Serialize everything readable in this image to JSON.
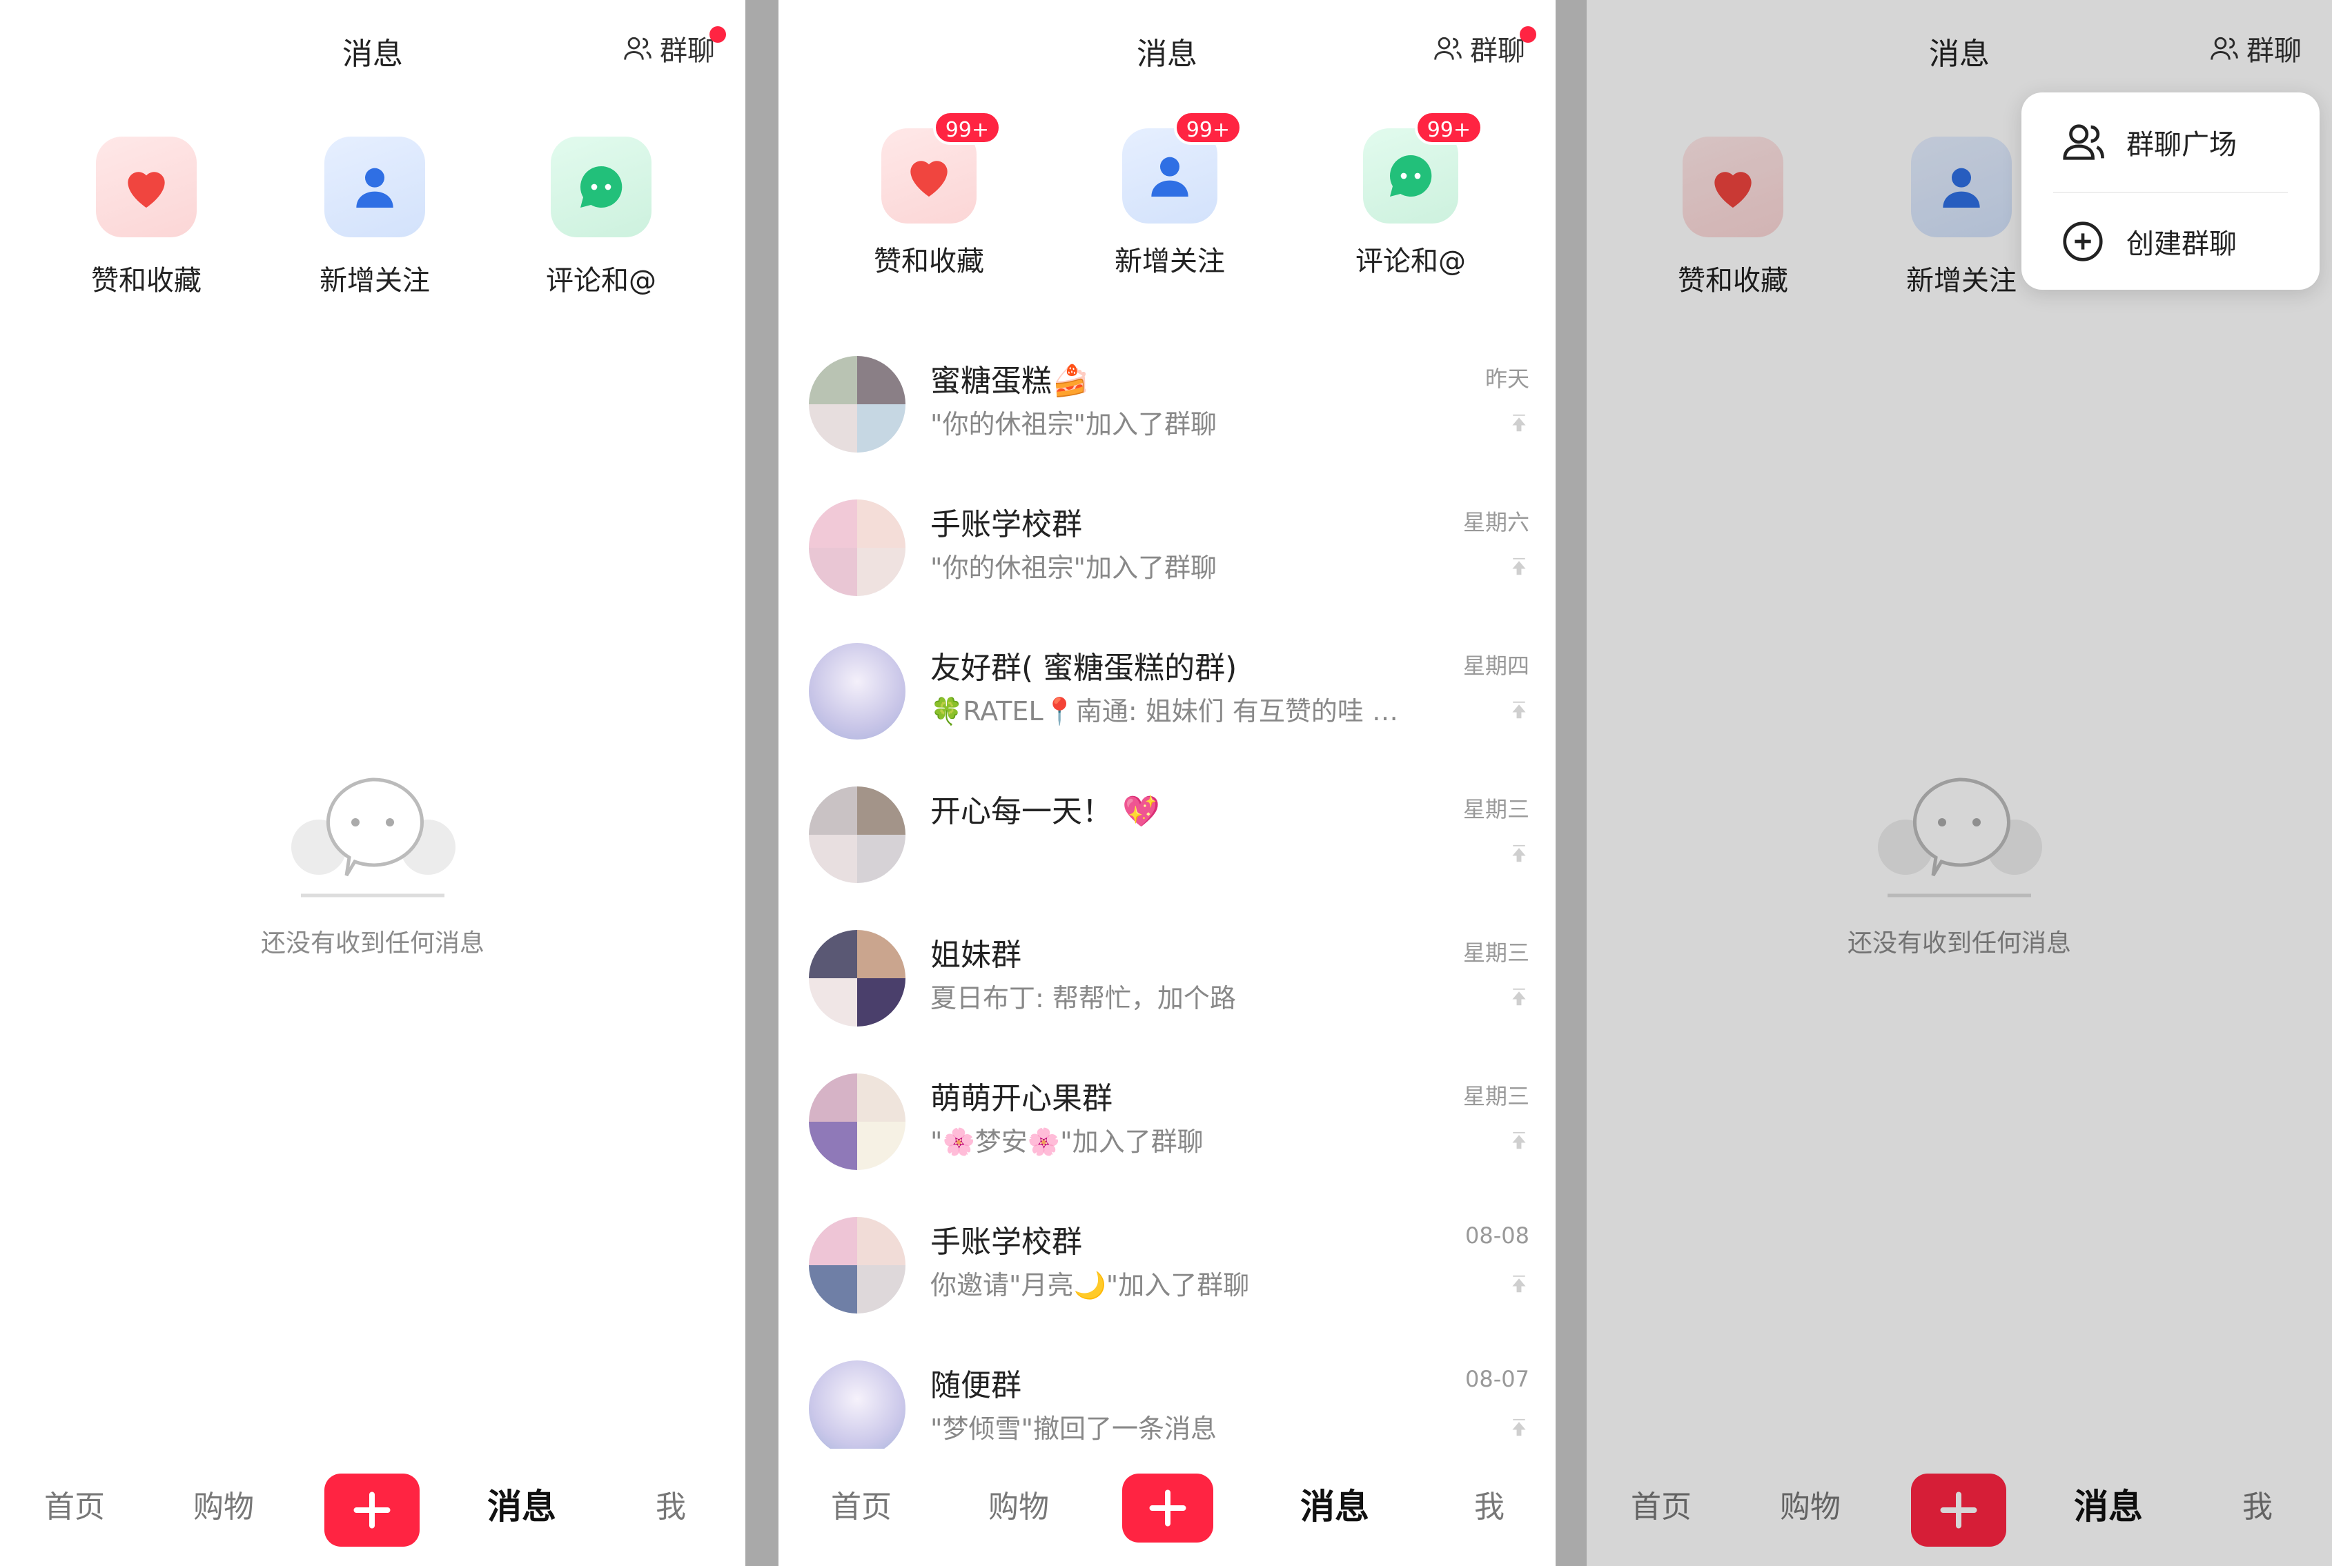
{
  "colors": {
    "brand_red": "#ff2442",
    "page_bg": "#ffffff",
    "gap_bg": "#a9a9a9"
  },
  "header": {
    "title": "消息",
    "group_chat_label": "群聊"
  },
  "entries": [
    {
      "label": "赞和收藏",
      "icon": "heart-icon"
    },
    {
      "label": "新增关注",
      "icon": "person-icon"
    },
    {
      "label": "评论和@",
      "icon": "chat-bubble-icon"
    }
  ],
  "entry_badge": "99+",
  "empty_state": {
    "text": "还没有收到任何消息"
  },
  "tabbar": {
    "home": "首页",
    "shop": "购物",
    "messages": "消息",
    "me": "我"
  },
  "chats": [
    {
      "name": "蜜糖蛋糕🍰",
      "subtitle": "\"你的休祖宗\"加入了群聊",
      "time": "昨天"
    },
    {
      "name": "手账学校群",
      "subtitle": "\"你的休祖宗\"加入了群聊",
      "time": "星期六"
    },
    {
      "name": "友好群( 蜜糖蛋糕的群)",
      "subtitle": "🍀RATEL📍南通: 姐妹们 有互赞的哇 …",
      "time": "星期四"
    },
    {
      "name": "开心每一天！ 💖",
      "subtitle": "",
      "time": "星期三"
    },
    {
      "name": "姐妹群",
      "subtitle": "夏日布丁: 帮帮忙，加个路",
      "time": "星期三"
    },
    {
      "name": "萌萌开心果群",
      "subtitle": "\"🌸梦安🌸\"加入了群聊",
      "time": "星期三"
    },
    {
      "name": "手账学校群",
      "subtitle": "你邀请\"月亮🌙\"加入了群聊",
      "time": "08-08"
    },
    {
      "name": "随便群",
      "subtitle": "\"梦倾雪\"撤回了一条消息",
      "time": "08-07"
    }
  ],
  "dropdown": {
    "square": "群聊广场",
    "create": "创建群聊"
  }
}
